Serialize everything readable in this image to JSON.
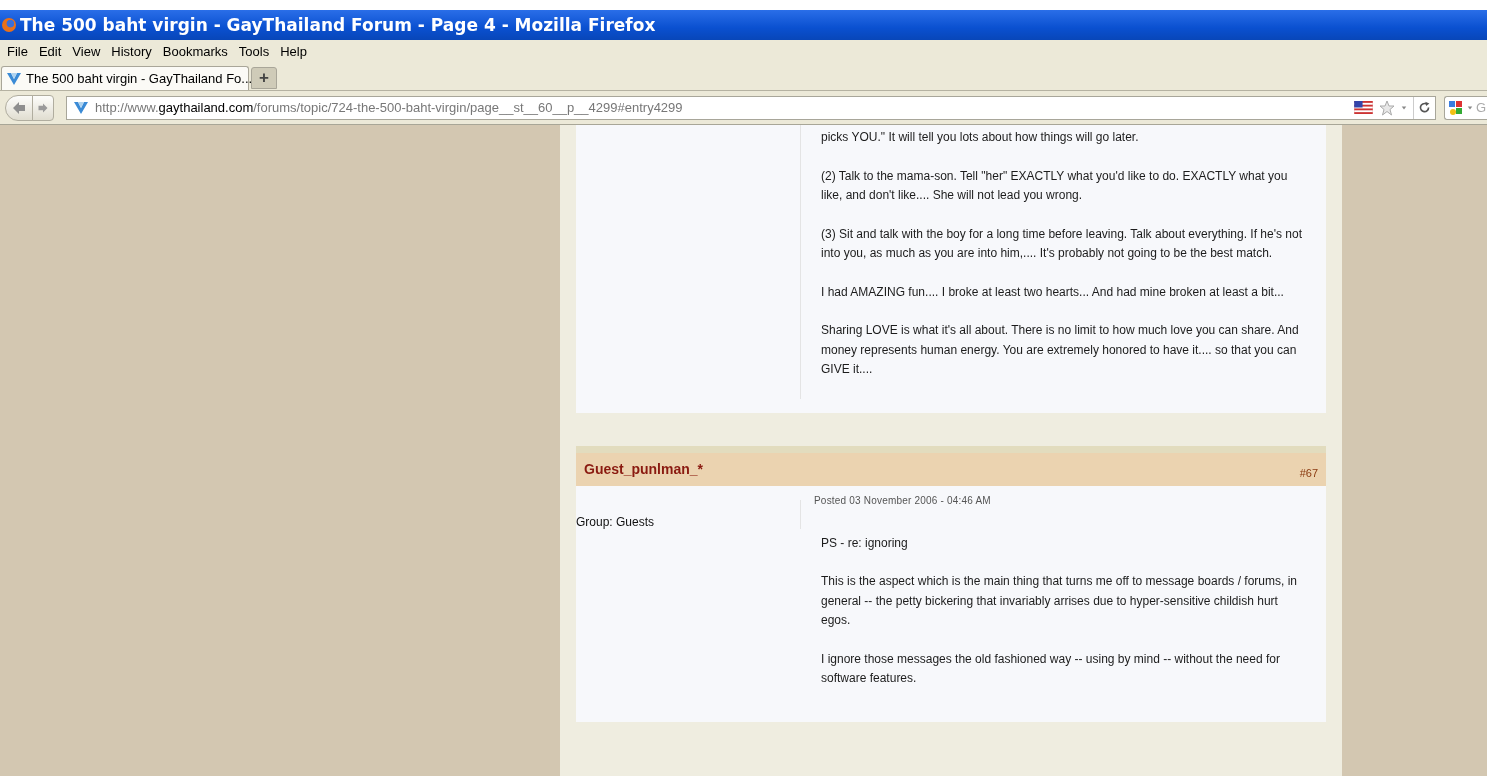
{
  "window": {
    "title": "The 500 baht virgin - GayThailand Forum - Page 4 - Mozilla Firefox"
  },
  "menu": [
    "File",
    "Edit",
    "View",
    "History",
    "Bookmarks",
    "Tools",
    "Help"
  ],
  "tabs": [
    {
      "label": "The 500 baht virgin - GayThailand Fo...",
      "selected": true
    }
  ],
  "new_tab": "+",
  "address": {
    "scheme": "http://www.",
    "domain": "gaythailand.com",
    "path": "/forums/topic/724-the-500-baht-virgin/page__st__60__p__4299#entry4299"
  },
  "search": {
    "placeholder": "G"
  },
  "posts": [
    {
      "paragraphs": [
        "picks YOU.\" It will tell you lots about how things will go later.",
        "(2) Talk to the mama-son. Tell \"her\" EXACTLY what you'd like to do. EXACTLY what you like, and don't like.... She will not lead you wrong.",
        "(3) Sit and talk with the boy for a long time before leaving. Talk about everything. If he's not into you, as much as you are into him,.... It's probably not going to be the best match.",
        "I had AMAZING fun.... I broke at least two hearts... And had mine broken at least a bit...",
        "Sharing LOVE is what it's all about. There is no limit to how much love you can share. And money represents human energy. You are extremely honored to have it.... so that you can GIVE it...."
      ]
    },
    {
      "author": "Guest_punlman_*",
      "number": "#67",
      "group": "Group: Guests",
      "posted": "Posted 03 November 2006 - 04:46 AM",
      "paragraphs": [
        "PS - re: ignoring",
        "This is the aspect which is the main thing that turns me off to message boards / forums, in general -- the petty bickering that invariably arrises due to hyper-sensitive childish hurt egos.",
        "I ignore those messages the old fashioned way -- using by mind -- without the need for software features."
      ]
    }
  ]
}
